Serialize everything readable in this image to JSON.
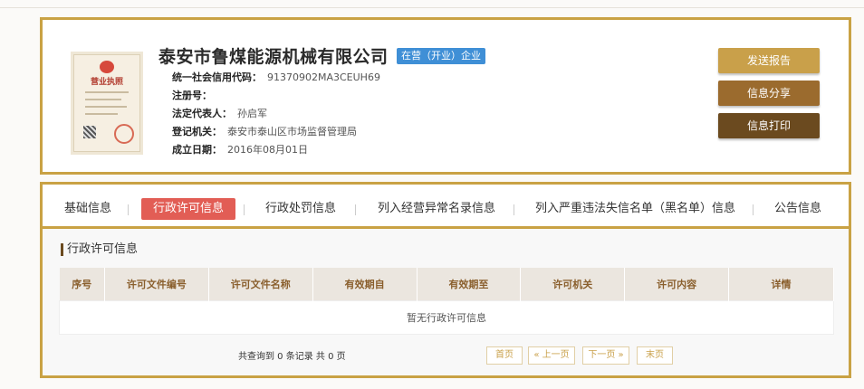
{
  "header": {
    "company_name": "泰安市鲁煤能源机械有限公司",
    "status_badge": "在营（开业）企业",
    "license_title": "营业执照",
    "fields": [
      {
        "label": "统一社会信用代码：",
        "value": "91370902MA3CEUH69"
      },
      {
        "label": "注册号：",
        "value": ""
      },
      {
        "label": "法定代表人：",
        "value": "孙启军"
      },
      {
        "label": "登记机关：",
        "value": "泰安市泰山区市场监督管理局"
      },
      {
        "label": "成立日期：",
        "value": "2016年08月01日"
      }
    ],
    "buttons": {
      "send_report": "发送报告",
      "share": "信息分享",
      "print": "信息打印"
    }
  },
  "tabs": [
    {
      "label": "基础信息"
    },
    {
      "label": "行政许可信息"
    },
    {
      "label": "行政处罚信息"
    },
    {
      "label": "列入经营异常名录信息"
    },
    {
      "label": "列入严重违法失信名单（黑名单）信息"
    },
    {
      "label": "公告信息"
    }
  ],
  "section": {
    "title": "行政许可信息",
    "columns": [
      "序号",
      "许可文件编号",
      "许可文件名称",
      "有效期自",
      "有效期至",
      "许可机关",
      "许可内容",
      "详情"
    ],
    "empty_text": "暂无行政许可信息"
  },
  "pagination": {
    "summary": "共查询到 0 条记录 共 0 页",
    "first": "首页",
    "prev": "« 上一页",
    "next": "下一页 »",
    "last": "末页"
  },
  "colors": {
    "border_gold": "#c9a244",
    "active_tab": "#e25d55",
    "badge_blue": "#3f8fd6"
  }
}
